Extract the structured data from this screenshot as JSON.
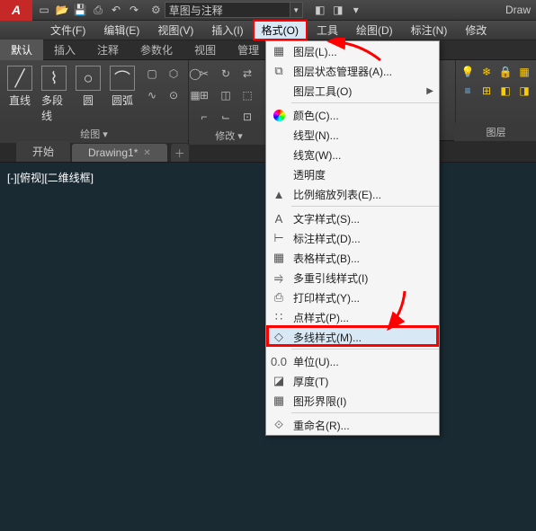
{
  "qat": {
    "workspace": "草图与注释",
    "title": "Draw"
  },
  "menubar": [
    "文件(F)",
    "编辑(E)",
    "视图(V)",
    "插入(I)",
    "格式(O)",
    "工具",
    "绘图(D)",
    "标注(N)",
    "修改"
  ],
  "menubar_active_index": 4,
  "ribbon_tabs": [
    "默认",
    "插入",
    "注释",
    "参数化",
    "视图",
    "管理"
  ],
  "ribbon_tabs_active": 0,
  "panels": {
    "draw": {
      "label": "绘图 ▾",
      "items": [
        "直线",
        "多段线",
        "圆",
        "圆弧"
      ]
    },
    "modify": {
      "label": "修改 ▾"
    },
    "layers": {
      "label": "图层"
    }
  },
  "doc_tabs": {
    "start": "开始",
    "active": "Drawing1*"
  },
  "canvas_label": "[-][俯视][二维线框]",
  "dropdown": [
    {
      "icon": "▦",
      "text": "图层(L)...",
      "key": "layer"
    },
    {
      "icon": "⧉",
      "text": "图层状态管理器(A)...",
      "key": "layer-state"
    },
    {
      "icon": "",
      "text": "图层工具(O)",
      "key": "layer-tools",
      "sub": true
    },
    {
      "sep": true
    },
    {
      "icon": "◉",
      "text": "颜色(C)...",
      "key": "color",
      "color": true
    },
    {
      "icon": "",
      "text": "线型(N)...",
      "key": "linetype"
    },
    {
      "icon": "",
      "text": "线宽(W)...",
      "key": "lineweight"
    },
    {
      "icon": "",
      "text": "透明度",
      "key": "transparency"
    },
    {
      "icon": "▲",
      "text": "比例缩放列表(E)...",
      "key": "scale"
    },
    {
      "sep": true
    },
    {
      "icon": "A",
      "text": "文字样式(S)...",
      "key": "text-style"
    },
    {
      "icon": "⊢",
      "text": "标注样式(D)...",
      "key": "dim-style"
    },
    {
      "icon": "▦",
      "text": "表格样式(B)...",
      "key": "table-style"
    },
    {
      "icon": "⥤",
      "text": "多重引线样式(I)",
      "key": "mleader"
    },
    {
      "icon": "⎙",
      "text": "打印样式(Y)...",
      "key": "plot-style"
    },
    {
      "icon": "∷",
      "text": "点样式(P)...",
      "key": "point-style"
    },
    {
      "icon": "◇",
      "text": "多线样式(M)...",
      "key": "mline-style",
      "hl": true
    },
    {
      "sep": true
    },
    {
      "icon": "0.0",
      "text": "单位(U)...",
      "key": "units"
    },
    {
      "icon": "◪",
      "text": "厚度(T)",
      "key": "thickness"
    },
    {
      "icon": "▦",
      "text": "图形界限(I)",
      "key": "limits"
    },
    {
      "sep": true
    },
    {
      "icon": "⟐",
      "text": "重命名(R)...",
      "key": "rename"
    }
  ]
}
